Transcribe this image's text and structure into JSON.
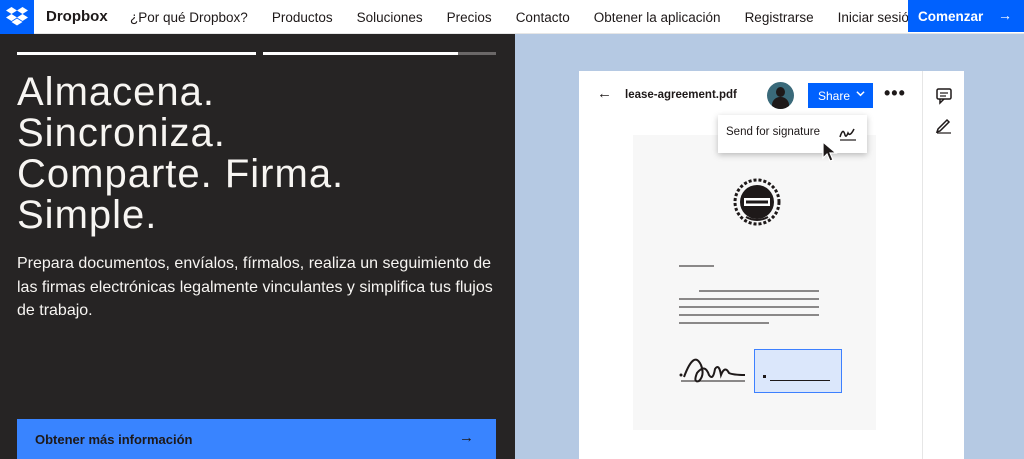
{
  "nav": {
    "brand": "Dropbox",
    "links": [
      "¿Por qué Dropbox?",
      "Productos",
      "Soluciones",
      "Precios",
      "Contacto",
      "Obtener la aplicación",
      "Registrarse",
      "Iniciar sesión"
    ],
    "cta_label": "Comenzar",
    "cta_arrow": "→",
    "brand_color": "#0061fe"
  },
  "hero": {
    "headline": [
      "Almacena.",
      "Sincroniza.",
      "Comparte. Firma.",
      "Simple."
    ],
    "subtitle": "Prepara documentos, envíalos, fírmalos, realiza un seguimiento de las firmas electrónicas legalmente vinculantes y simplifica tus flujos de trabajo.",
    "learn_more_label": "Obtener más información",
    "learn_more_arrow": "→",
    "progress": [
      1.0,
      0.84
    ]
  },
  "preview": {
    "back_arrow": "←",
    "filename": "lease-agreement.pdf",
    "share_label": "Share",
    "share_chevron": "⌄",
    "more_label": "•••",
    "dropdown_item": "Send for signature",
    "icons": {
      "signature_icon": "signature-icon",
      "comment_icon": "comment-icon",
      "edit_icon": "pencil-icon",
      "cursor_icon": "cursor-icon",
      "seal_icon": "seal-icon"
    }
  }
}
